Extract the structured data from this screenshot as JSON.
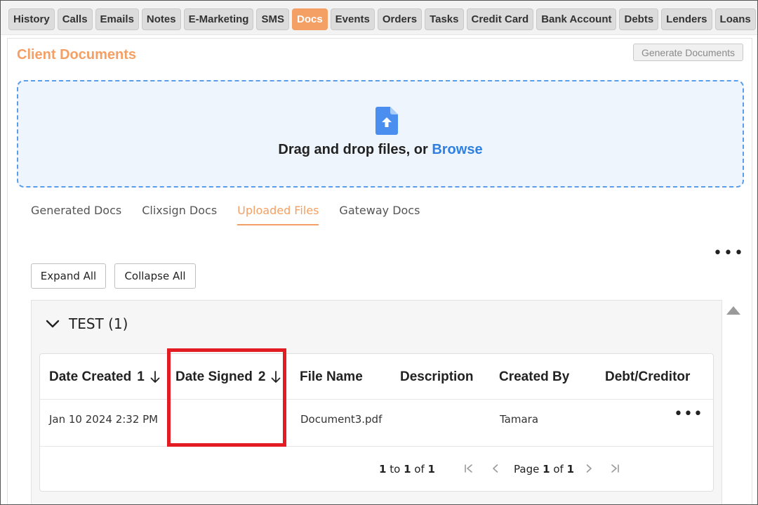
{
  "top_tabs": [
    "History",
    "Calls",
    "Emails",
    "Notes",
    "E-Marketing",
    "SMS",
    "Docs",
    "Events",
    "Orders",
    "Tasks",
    "Credit Card",
    "Bank Account",
    "Debts",
    "Lenders",
    "Loans"
  ],
  "active_top_tab": "Docs",
  "page": {
    "title": "Client Documents",
    "generate_button": "Generate Documents"
  },
  "dropzone": {
    "icon": "file-upload-icon",
    "text": "Drag and drop files, or ",
    "browse": "Browse"
  },
  "doc_tabs": [
    "Generated Docs",
    "Clixsign Docs",
    "Uploaded Files",
    "Gateway Docs"
  ],
  "active_doc_tab": "Uploaded Files",
  "actions": {
    "more": "•••",
    "expand_all": "Expand All",
    "collapse_all": "Collapse All"
  },
  "group": {
    "title": "TEST (1)"
  },
  "table": {
    "columns": [
      {
        "label": "Date Created",
        "sort_order": "1"
      },
      {
        "label": "Date Signed",
        "sort_order": "2"
      },
      {
        "label": "File Name"
      },
      {
        "label": "Description"
      },
      {
        "label": "Created By"
      },
      {
        "label": "Debt/Creditor"
      }
    ],
    "rows": [
      {
        "date_created": "Jan 10 2024 2:32 PM",
        "date_signed": "",
        "file_name": "Document3.pdf",
        "description": "",
        "created_by": "Tamara",
        "debt_creditor": "",
        "more": "•••"
      }
    ]
  },
  "pager": {
    "from": "1",
    "to_word": "to",
    "to": "1",
    "of_word": "of",
    "total": "1",
    "page_word": "Page",
    "page": "1",
    "page_of_word": "of",
    "page_total": "1",
    "first_icon": "first-page-icon",
    "prev_icon": "prev-page-icon",
    "next_icon": "next-page-icon",
    "last_icon": "last-page-icon"
  },
  "colors": {
    "accent": "#f4a064",
    "link": "#2f80e0",
    "highlight": "#e31b23"
  }
}
